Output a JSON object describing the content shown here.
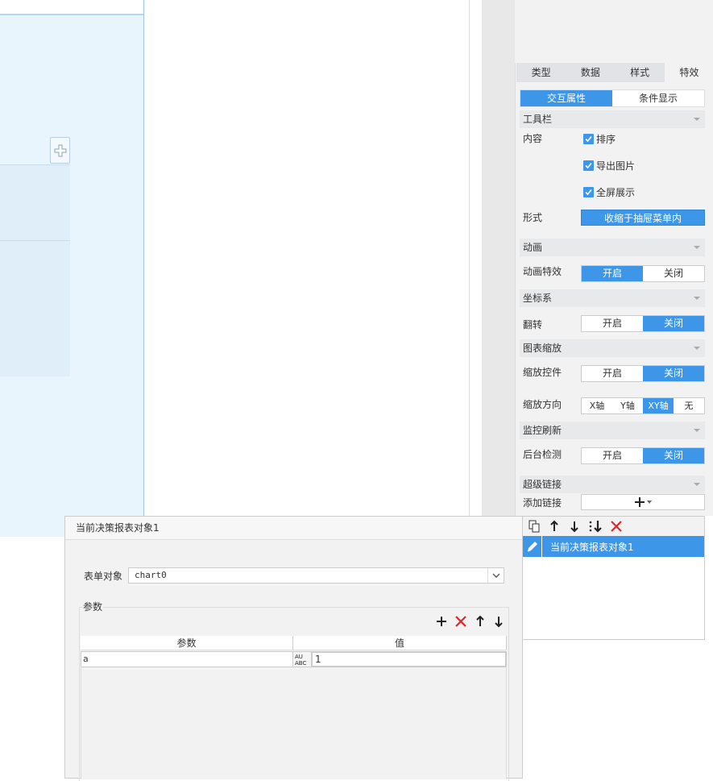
{
  "tabs": [
    "类型",
    "数据",
    "样式",
    "特效"
  ],
  "active_tab": "特效",
  "subtabs": [
    "交互属性",
    "条件显示"
  ],
  "active_subtab": "交互属性",
  "toolbar_section": {
    "title": "工具栏",
    "content_label": "内容",
    "checks": [
      {
        "label": "排序",
        "checked": true
      },
      {
        "label": "导出图片",
        "checked": true
      },
      {
        "label": "全屏展示",
        "checked": true
      }
    ],
    "form_label": "形式",
    "form_value": "收缩于抽屉菜单内"
  },
  "animation_section": {
    "title": "动画",
    "effect_label": "动画特效",
    "options": [
      "开启",
      "关闭"
    ],
    "selected": "开启"
  },
  "coord_section": {
    "title": "坐标系",
    "flip_label": "翻转",
    "options": [
      "开启",
      "关闭"
    ],
    "selected": "关闭"
  },
  "zoom_section": {
    "title": "图表缩放",
    "control_label": "缩放控件",
    "control_options": [
      "开启",
      "关闭"
    ],
    "control_selected": "关闭",
    "direction_label": "缩放方向",
    "direction_options": [
      "X轴",
      "Y轴",
      "XY轴",
      "无"
    ],
    "direction_selected": "XY轴"
  },
  "monitor_section": {
    "title": "监控刷新",
    "bg_label": "后台检测",
    "options": [
      "开启",
      "关闭"
    ],
    "selected": "关闭"
  },
  "hyperlink_section": {
    "title": "超级链接",
    "add_label": "添加链接",
    "items": [
      "当前决策报表对象1"
    ]
  },
  "dialog": {
    "title": "当前决策报表对象1",
    "form_object_label": "表单对象",
    "form_object_value": "chart0",
    "params_group_label": "参数",
    "param_header": "参数",
    "value_header": "值",
    "type_badge": "AU ABC",
    "rows": [
      {
        "param": "a",
        "value": "1"
      }
    ]
  },
  "colors": {
    "accent": "#3d96e8",
    "panel_bg": "#f2f2f3",
    "danger": "#e0262a"
  }
}
